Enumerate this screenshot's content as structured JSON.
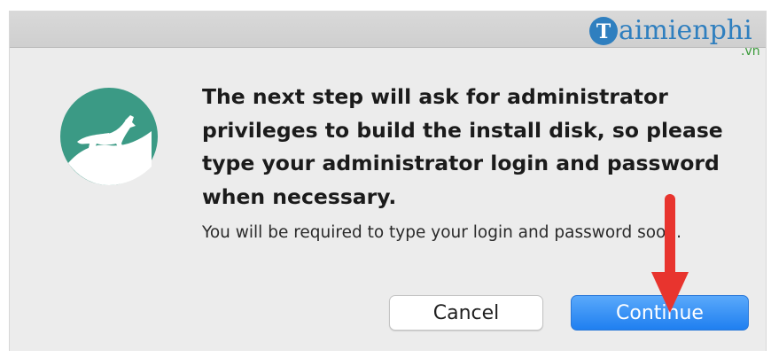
{
  "dialog": {
    "headline": "The next step will ask for administrator privileges to build the install disk, so please type your administrator login and password when necessary.",
    "message": "You will be required to type your login and password soon.",
    "icon": "cougar-app-icon",
    "buttons": {
      "cancel_label": "Cancel",
      "continue_label": "Continue"
    },
    "colors": {
      "icon_teal": "#3b9a85",
      "continue_blue": "#2f8cf5",
      "arrow_red": "#e8342e"
    }
  },
  "annotation": {
    "icon": "red-arrow-icon"
  },
  "watermark": {
    "logo_letter": "T",
    "brand_text": "aimienphi",
    "suffix": ".vn"
  }
}
